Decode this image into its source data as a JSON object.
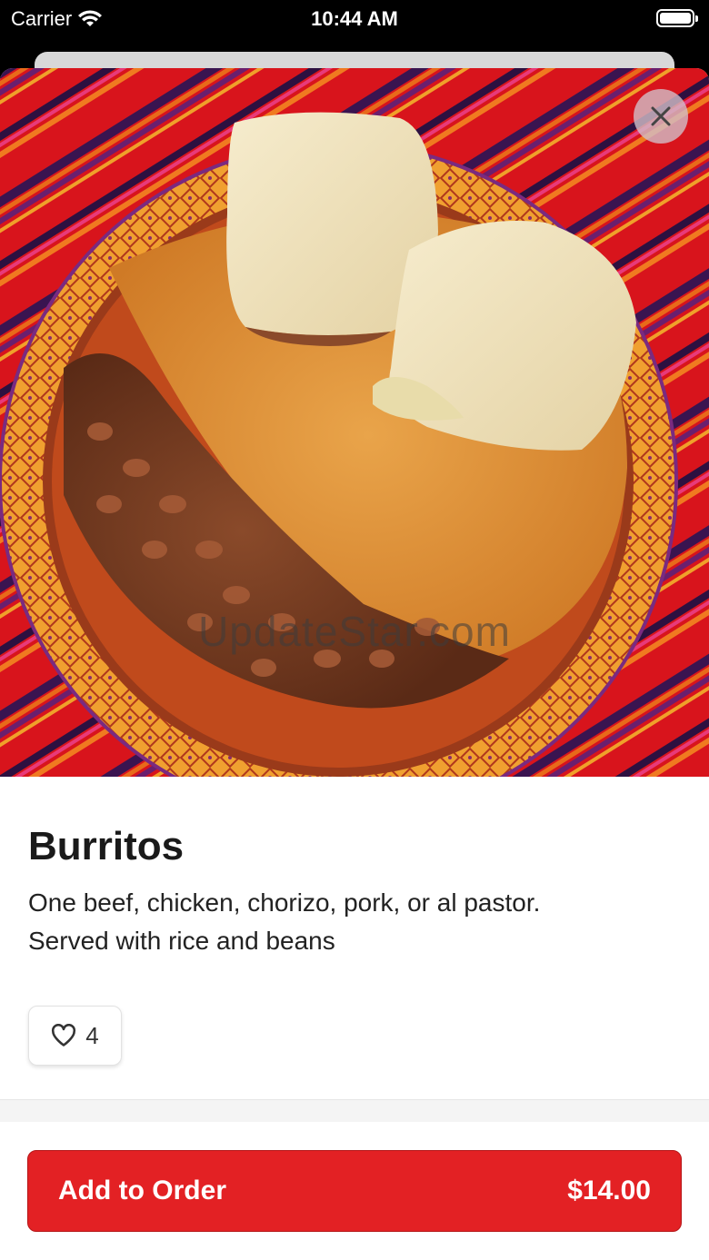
{
  "status_bar": {
    "carrier": "Carrier",
    "time": "10:44 AM"
  },
  "hero": {
    "watermark": "UpdateStar.com",
    "close_icon": "close-icon"
  },
  "item": {
    "title": "Burritos",
    "description_line1": "One beef, chicken, chorizo, pork, or al pastor.",
    "description_line2": "Served with rice and beans",
    "likes": "4"
  },
  "footer": {
    "button_label": "Add to Order",
    "price": "$14.00"
  },
  "colors": {
    "accent": "#e32124",
    "background": "#ffffff"
  }
}
